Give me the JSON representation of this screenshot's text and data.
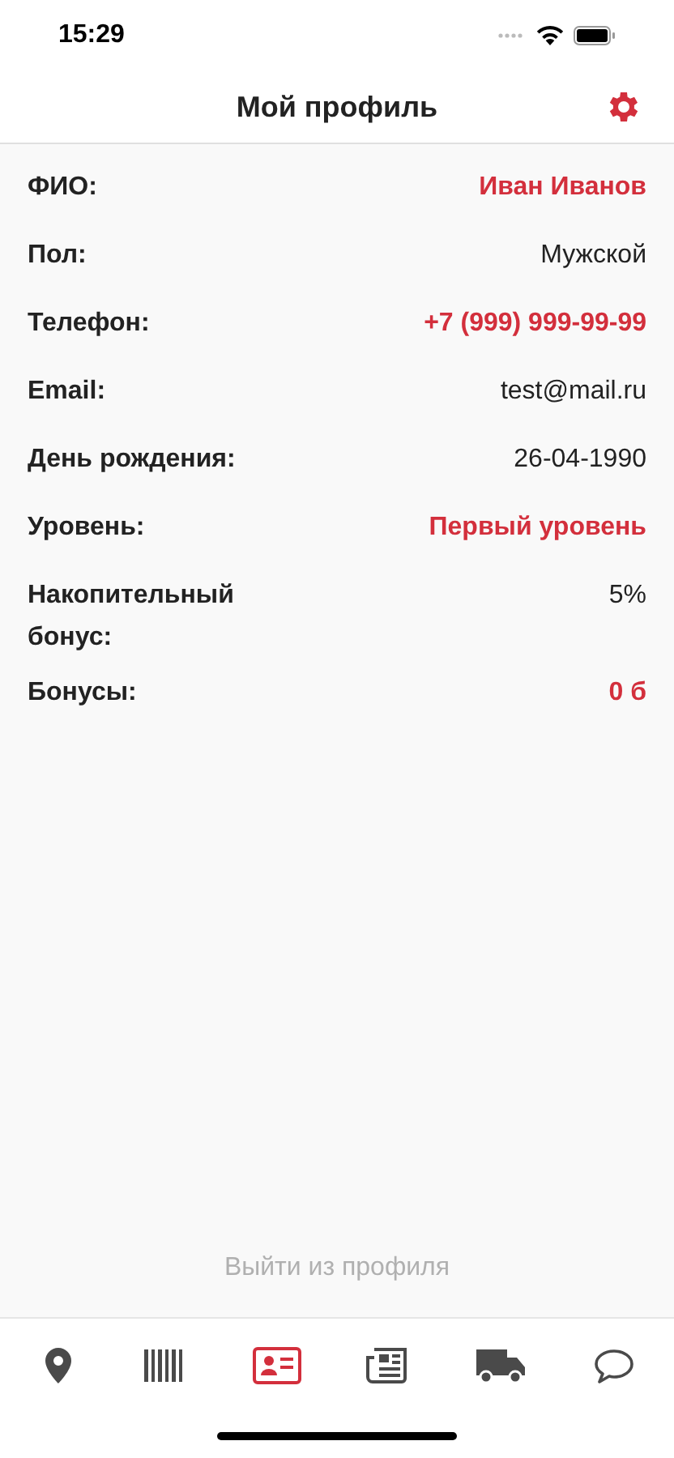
{
  "status_bar": {
    "time": "15:29"
  },
  "header": {
    "title": "Мой профиль"
  },
  "fields": [
    {
      "label": "ФИО:",
      "value": "Иван Иванов",
      "accent": true
    },
    {
      "label": "Пол:",
      "value": "Мужской",
      "accent": false
    },
    {
      "label": "Телефон:",
      "value": "+7 (999) 999-99-99",
      "accent": true
    },
    {
      "label": "Email:",
      "value": "test@mail.ru",
      "accent": false
    },
    {
      "label": "День рождения:",
      "value": "26-04-1990",
      "accent": false
    },
    {
      "label": "Уровень:",
      "value": "Первый уровень",
      "accent": true
    },
    {
      "label": "Накопительный бонус:",
      "value": "5%",
      "accent": false
    },
    {
      "label": "Бонусы:",
      "value": "0 б",
      "accent": true
    }
  ],
  "logout": {
    "label": "Выйти из профиля"
  },
  "tab_bar": [
    {
      "kind": "map",
      "selected": false
    },
    {
      "kind": "barcode",
      "selected": false
    },
    {
      "kind": "profile",
      "selected": true
    },
    {
      "kind": "news",
      "selected": false
    },
    {
      "kind": "delivery",
      "selected": false
    },
    {
      "kind": "chat",
      "selected": false
    }
  ]
}
